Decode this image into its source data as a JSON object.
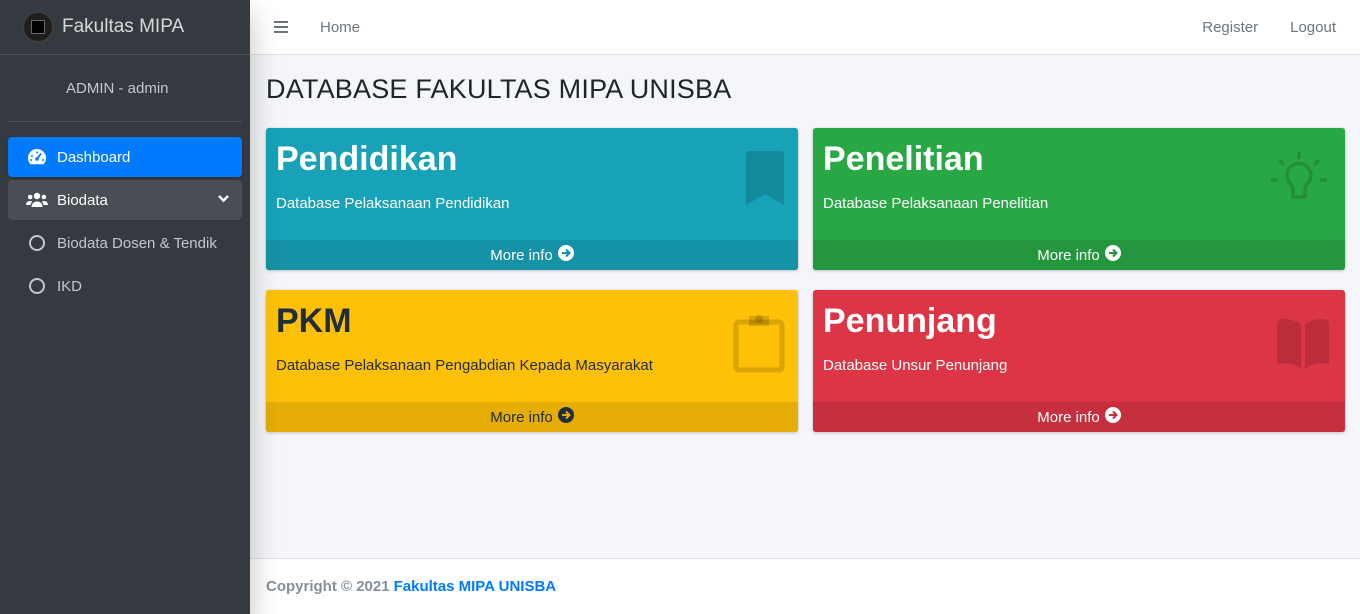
{
  "brand": {
    "name": "Fakultas MIPA"
  },
  "user": {
    "name": "ADMIN - admin"
  },
  "sidebar": {
    "items": [
      {
        "label": "Dashboard",
        "icon": "dashboard-icon",
        "active": true
      },
      {
        "label": "Biodata",
        "icon": "users-icon",
        "expanded": true
      },
      {
        "label": "Biodata Dosen & Tendik",
        "icon": "circle-icon"
      },
      {
        "label": "IKD",
        "icon": "circle-icon"
      }
    ]
  },
  "topbar": {
    "home": "Home",
    "register": "Register",
    "logout": "Logout"
  },
  "main": {
    "title": "DATABASE FAKULTAS MIPA UNISBA",
    "cards": [
      {
        "title": "Pendidikan",
        "desc": "Database Pelaksanaan Pendidikan",
        "link": "More info",
        "icon": "bookmark-icon",
        "color": "#17a2b8"
      },
      {
        "title": "Penelitian",
        "desc": "Database Pelaksanaan Penelitian",
        "link": "More info",
        "icon": "lightbulb-icon",
        "color": "#28a745"
      },
      {
        "title": "PKM",
        "desc": "Database Pelaksanaan Pengabdian Kepada Masyarakat",
        "link": "More info",
        "icon": "clipboard-icon",
        "color": "#ffc107"
      },
      {
        "title": "Penunjang",
        "desc": "Database Unsur Penunjang",
        "link": "More info",
        "icon": "book-open-icon",
        "color": "#dc3545"
      }
    ]
  },
  "footer": {
    "copyright": "Copyright © 2021",
    "org": "Fakultas MIPA UNISBA"
  }
}
